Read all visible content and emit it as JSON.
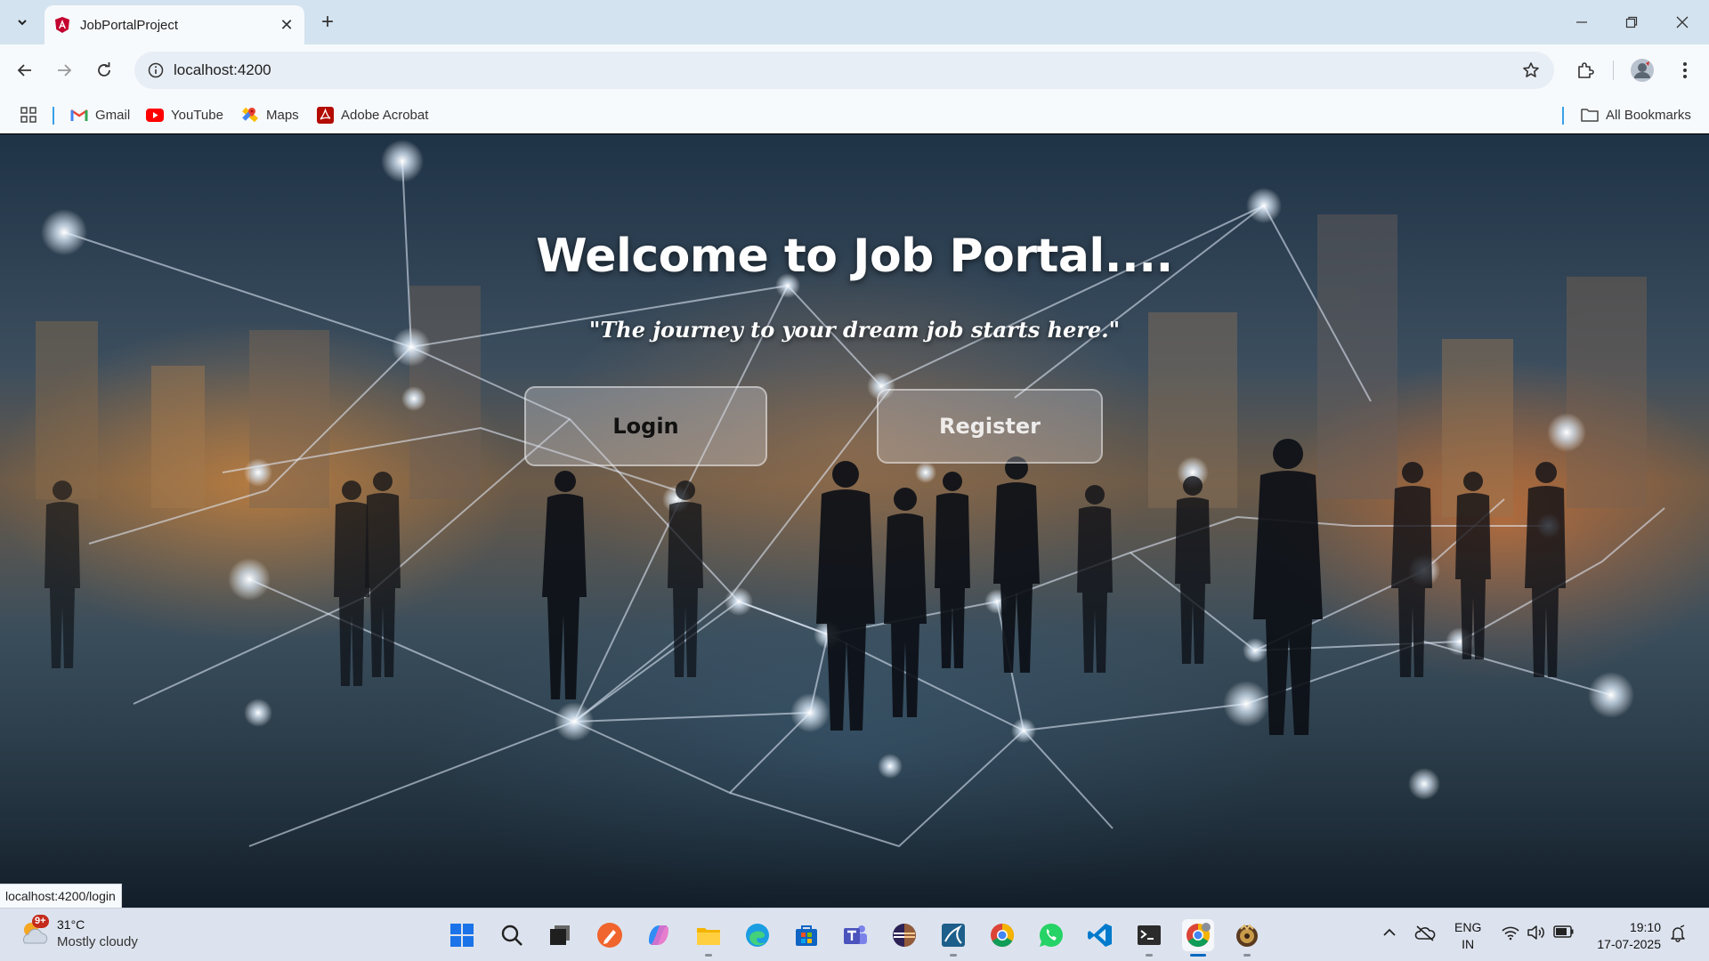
{
  "browser": {
    "tab_title": "JobPortalProject",
    "url": "localhost:4200",
    "bookmarks": [
      {
        "label": "Gmail",
        "icon": "gmail-icon"
      },
      {
        "label": "YouTube",
        "icon": "youtube-icon"
      },
      {
        "label": "Maps",
        "icon": "maps-icon"
      },
      {
        "label": "Adobe Acrobat",
        "icon": "acrobat-icon"
      }
    ],
    "all_bookmarks_label": "All Bookmarks",
    "status_url": "localhost:4200/login"
  },
  "hero": {
    "title": "Welcome to Job Portal....",
    "subtitle": "\"The journey to your dream job starts here.\"",
    "login_label": "Login",
    "register_label": "Register"
  },
  "taskbar": {
    "weather_temp": "31°C",
    "weather_desc": "Mostly cloudy",
    "weather_badge": "9+",
    "lang_line1": "ENG",
    "lang_line2": "IN",
    "time": "19:10",
    "date": "17-07-2025"
  },
  "colors": {
    "tabstrip": "#d3e3ef",
    "toolbar": "#f7fafd",
    "taskbar": "#dde3ee",
    "accent": "#0067c0"
  }
}
